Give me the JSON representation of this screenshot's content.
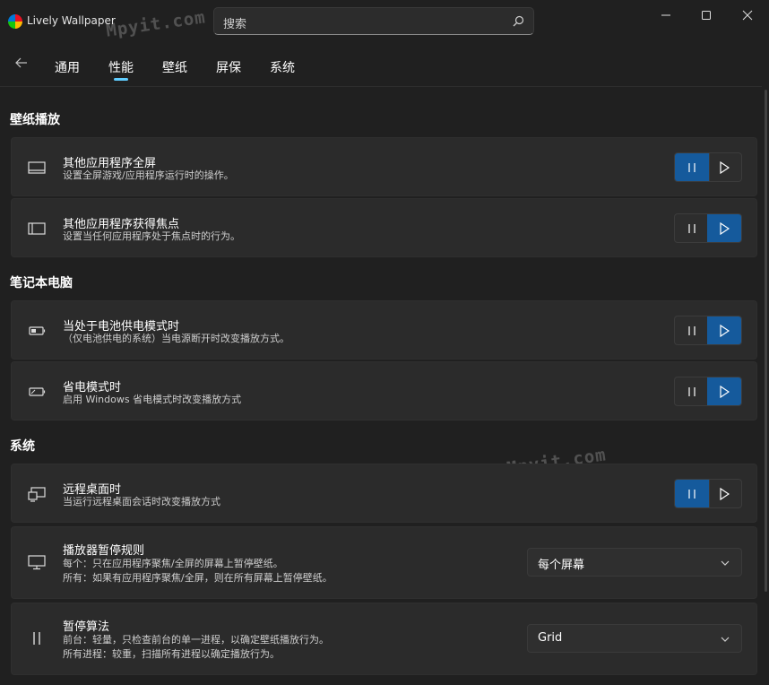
{
  "window": {
    "title": "Lively Wallpaper"
  },
  "watermarks": [
    "Mpyit.com",
    "Mpyit.com"
  ],
  "search": {
    "placeholder": "搜索"
  },
  "tabs": [
    {
      "label": "通用"
    },
    {
      "label": "性能"
    },
    {
      "label": "壁纸"
    },
    {
      "label": "屏保"
    },
    {
      "label": "系统"
    }
  ],
  "active_tab": "性能",
  "accent_color": "#155a9c",
  "sections": {
    "wallpaper_playback": {
      "title": "壁纸播放",
      "items": [
        {
          "title": "其他应用程序全屏",
          "description": "设置全屏游戏/应用程序运行时的操作。",
          "selected": "pause"
        },
        {
          "title": "其他应用程序获得焦点",
          "description": "设置当任何应用程序处于焦点时的行为。",
          "selected": "play"
        }
      ]
    },
    "laptop": {
      "title": "笔记本电脑",
      "items": [
        {
          "title": "当处于电池供电模式时",
          "description": "（仅电池供电的系统）当电源断开时改变播放方式。",
          "selected": "play"
        },
        {
          "title": "省电模式时",
          "description": "启用 Windows 省电模式时改变播放方式",
          "selected": "play"
        }
      ]
    },
    "system": {
      "title": "系统",
      "remote": {
        "title": "远程桌面时",
        "description": "当运行远程桌面会话时改变播放方式",
        "selected": "pause"
      },
      "pause_rule": {
        "title": "播放器暂停规则",
        "description_1": "每个：只在应用程序聚焦/全屏的屏幕上暂停壁纸。",
        "description_2": "所有：如果有应用程序聚焦/全屏，则在所有屏幕上暂停壁纸。",
        "value": "每个屏幕"
      },
      "pause_algorithm": {
        "title": "暂停算法",
        "description_1": "前台：轻量，只检查前台的单一进程，以确定壁纸播放行为。",
        "description_2": "所有进程：较重，扫描所有进程以确定播放行为。",
        "value": "Grid"
      }
    }
  }
}
